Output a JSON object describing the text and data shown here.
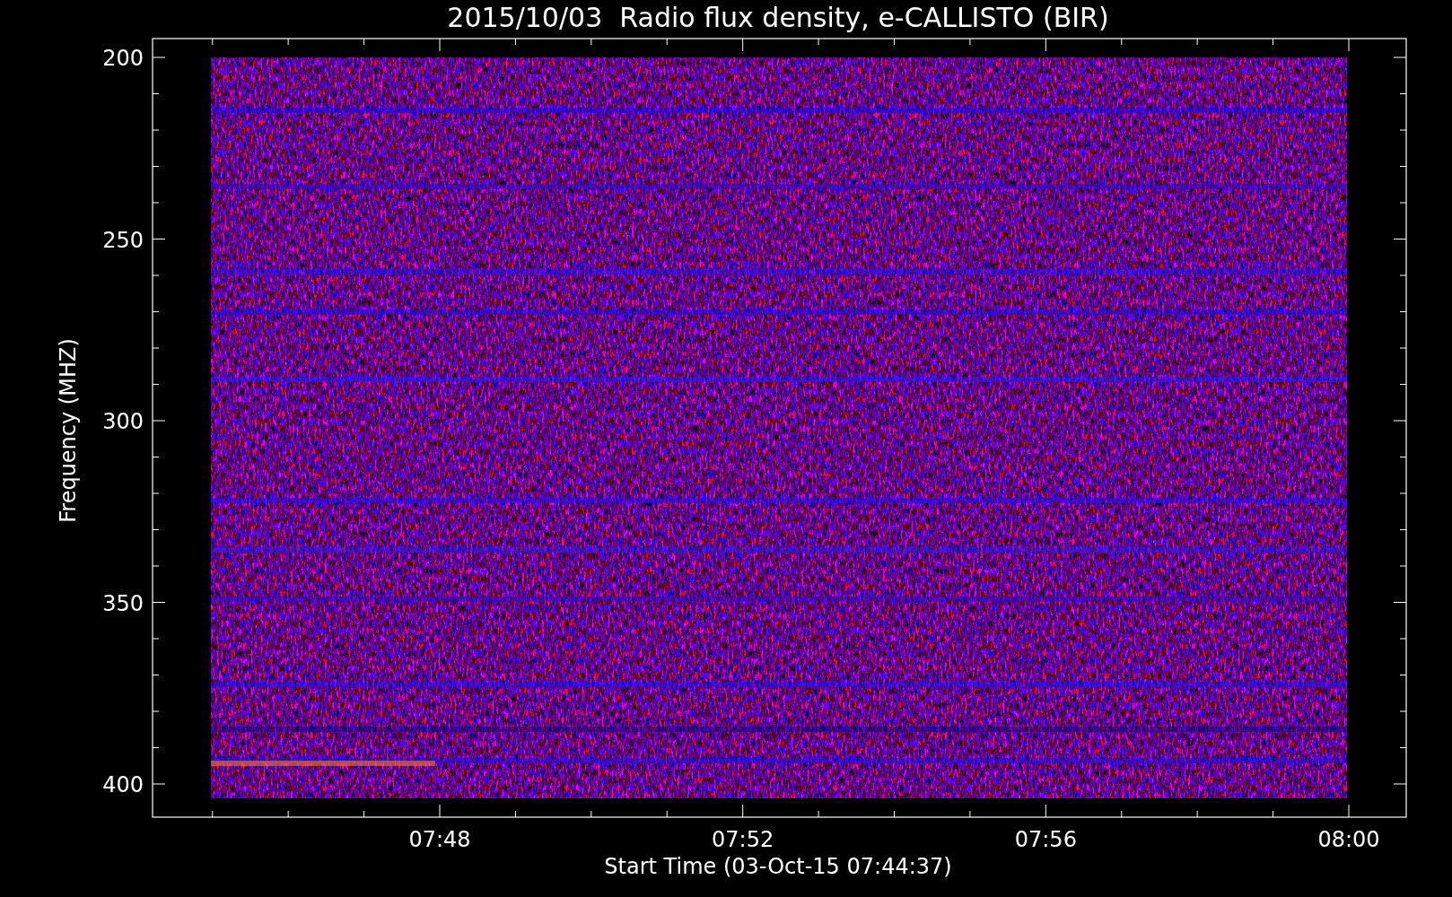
{
  "title": "2015/10/03  Radio flux density, e-CALLISTO (BIR)",
  "y_axis": {
    "label": "Frequency (MHZ)",
    "ticks": [
      "200",
      "250",
      "300",
      "350",
      "400"
    ]
  },
  "x_axis": {
    "label": "Start Time (03-Oct-15 07:44:37)",
    "ticks": [
      "07:48",
      "07:52",
      "07:56",
      "08:00"
    ]
  }
}
